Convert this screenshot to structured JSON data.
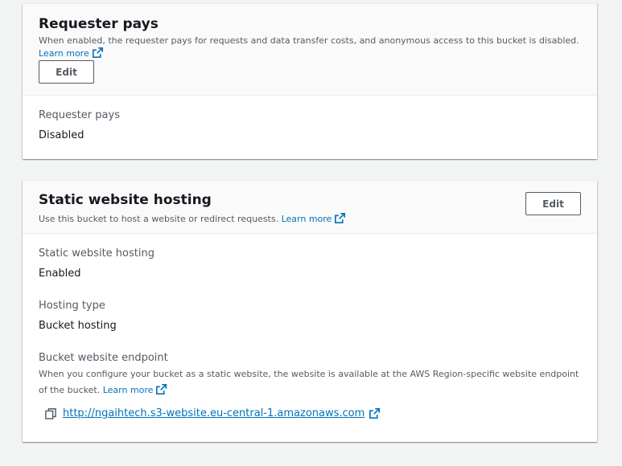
{
  "requester_pays": {
    "title": "Requester pays",
    "description": "When enabled, the requester pays for requests and data transfer costs, and anonymous access to this bucket is disabled.",
    "learn_more": "Learn more",
    "edit_label": "Edit",
    "field_label": "Requester pays",
    "field_value": "Disabled"
  },
  "static_hosting": {
    "title": "Static website hosting",
    "description": "Use this bucket to host a website or redirect requests.",
    "learn_more": "Learn more",
    "edit_label": "Edit",
    "status_label": "Static website hosting",
    "status_value": "Enabled",
    "type_label": "Hosting type",
    "type_value": "Bucket hosting",
    "endpoint_label": "Bucket website endpoint",
    "endpoint_description": "When you configure your bucket as a static website, the website is available at the AWS Region-specific website endpoint of the bucket.",
    "endpoint_learn_more": "Learn more",
    "endpoint_url": "http://ngaihtech.s3-website.eu-central-1.amazonaws.com"
  },
  "colors": {
    "link": "#0073bb",
    "text": "#16191f",
    "secondary_text": "#545b64",
    "background": "#f2f3f3"
  }
}
